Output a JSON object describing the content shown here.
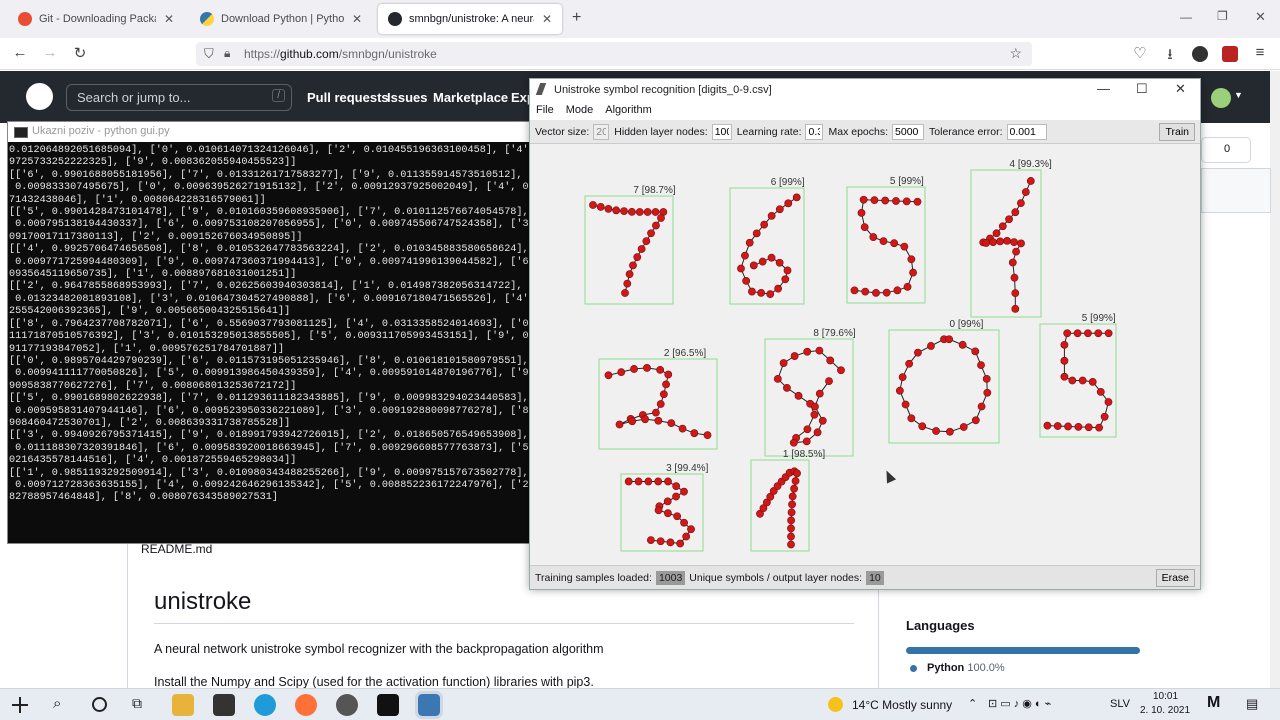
{
  "browser": {
    "tabs": [
      {
        "label": "Git - Downloading Package"
      },
      {
        "label": "Download Python | Python.org"
      },
      {
        "label": "smnbgn/unistroke: A neural net"
      }
    ],
    "url_prefix": "https://",
    "url_host": "github.com",
    "url_path": "/smnbgn/unistroke"
  },
  "github": {
    "search_placeholder": "Search or jump to...",
    "search_key": "/",
    "nav": [
      "Pull requests",
      "Issues",
      "Marketplace",
      "Exp"
    ],
    "badge_count": "0",
    "readme_file": "README.md",
    "heading": "unistroke",
    "description": "A neural network unistroke symbol recognizer with the backpropagation algorithm",
    "install_text": "Install the Numpy and Scipy (used for the activation function) libraries with pip3.",
    "languages_title": "Languages",
    "language_name": "Python",
    "language_pct": "100.0%",
    "language_color": "#3572A5"
  },
  "console": {
    "title": "Ukazni poziv - python  gui.py",
    "lines": [
      "0.012064892051685094], ['0', 0.010614071324126046], ['2', 0.010455196363100458], ['4',",
      "9725733252222325], ['9', 0.008362055940455523]]",
      "[['6', 0.9901688055181956], ['7', 0.01331261717583277], ['9', 0.011355914573510512], ['",
      " 0.009833307495675], ['0', 0.009639526271915132], ['2', 0.00912937925002049], ['4', 0.00",
      "71432438046], ['1', 0.008064228316579061]]",
      "[['5', 0.9901428473101478], ['9', 0.010160359608935906], ['7', 0.010112576674054578], [",
      " 0.009795138194430337], ['6', 0.009753108207056955], ['0', 0.009745506747524358], ['3',",
      "09170017117380113], ['2', 0.009152676034950895]]",
      "[['4', 0.9925706474656508], ['8', 0.010532647783563224], ['2', 0.010345883580658624], [",
      " 0.009771725994480309], ['9', 0.009747360371994413], ['0', 0.009741996139044582], ['6',",
      "0935645119650735], ['1', 0.008897681031001251]]",
      "[['2', 0.9647855868953993], ['7', 0.02625603940303814], ['1', 0.014987382056314722], ['",
      " 0.01323482081893108], ['3', 0.010647304527490888], ['6', 0.009167180471565526], ['4',",
      "255542006392365], ['9', 0.005665004325515641]]",
      "[['8', 0.7964237708782071], ['6', 0.5569037793081125], ['4', 0.0313358524014693], ['0'",
      "11171870510576392], ['3', 0.010153295013855505], ['5', 0.009311705993453151], ['9', 0.0",
      "91177193847052], ['1', 0.009576251784701887]]",
      "[['0', 0.9895704429790239], ['6', 0.011573195051235946], ['8', 0.010618101580979551], [",
      " 0.009941111770050826], ['5', 0.009913986450439359], ['4', 0.009591014870196776], ['9',",
      "9095838770627276], ['7', 0.008068013253672172]]",
      "[['5', 0.9901689802622938], ['7', 0.011293611182343885], ['9', 0.009983294023440583], [",
      " 0.009595831407944146], ['6', 0.009523950336221089], ['3', 0.009192880098776278], ['8',",
      "908460472530701], ['2', 0.008639331738785528]]",
      "[['3', 0.9940926795371415], ['9', 0.018991793942726015], ['2', 0.018650576549653908], [",
      " 0.011188307320391846], ['6', 0.009583920018663945], ['7', 0.009296608577763873], ['5',",
      "0216435578144516], ['4', 0.001872559465298034]]",
      "[['1', 0.9851193292509914], ['3', 0.010980343488255266], ['9', 0.009975157673502778], [",
      " 0.009712728363635155], ['4', 0.009242646296135342], ['5', 0.008852236172247976], ['2',",
      "82788957464848], ['8', 0.008076343589027531]"
    ]
  },
  "app": {
    "title": "Unistroke symbol recognition [digits_0-9.csv]",
    "menu": [
      "File",
      "Mode",
      "Algorithm"
    ],
    "params": [
      {
        "label": "Vector size:",
        "value": "20"
      },
      {
        "label": "Hidden layer nodes:",
        "value": "100"
      },
      {
        "label": "Learning rate:",
        "value": "0.3"
      },
      {
        "label": "Max epochs:",
        "value": "5000"
      },
      {
        "label": "Tolerance error:",
        "value": "0.001"
      }
    ],
    "train_button": "Train",
    "erase_button": "Erase",
    "status_samples_label": "Training samples loaded:",
    "status_samples_value": "1003",
    "status_symbols_label": "Unique symbols / output layer nodes:",
    "status_symbols_value": "10",
    "point_color": "#d01818",
    "box_color": "#8fdc8f",
    "symbols": [
      "7 [98.7%]",
      "6 [99%]",
      "5 [99%]",
      "4 [99.3%]",
      "2 [96.5%]",
      "8 [79.6%]",
      "0 [99%]",
      "5 [99%]",
      "3 [99.4%]",
      "1 [98.5%]"
    ]
  },
  "taskbar": {
    "weather": "14°C  Mostly sunny",
    "lang": "SLV",
    "time": "10:01",
    "date": "2. 10. 2021"
  }
}
